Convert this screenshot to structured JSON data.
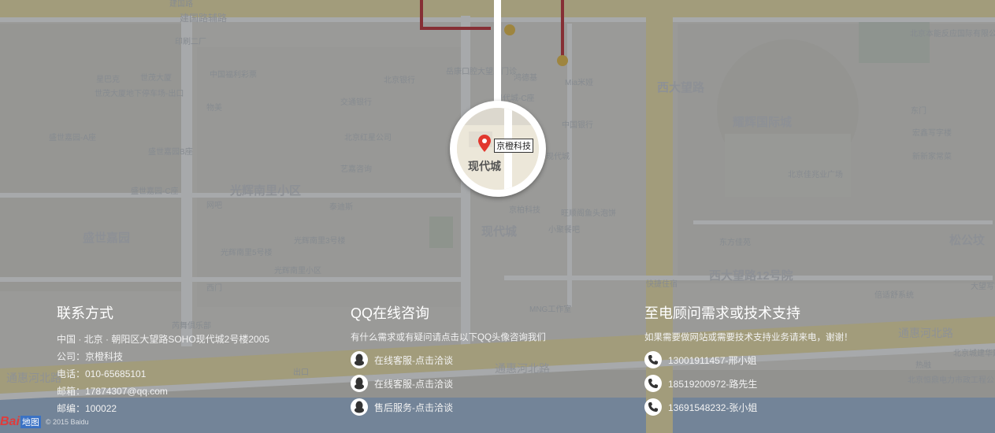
{
  "map": {
    "labels": [
      {
        "t": "建国路",
        "cls": ""
      },
      {
        "t": "建国路辅路",
        "cls": "mid"
      },
      {
        "t": "印刷二厂",
        "cls": ""
      },
      {
        "t": "中国福利彩票",
        "cls": ""
      },
      {
        "t": "北京银行",
        "cls": ""
      },
      {
        "t": "岳康口腔大望路门诊",
        "cls": ""
      },
      {
        "t": "鸿德基",
        "cls": ""
      },
      {
        "t": "Mia米娅",
        "cls": ""
      },
      {
        "t": "星巴克",
        "cls": ""
      },
      {
        "t": "世茂大厦",
        "cls": ""
      },
      {
        "t": "世茂大厦地下停车场-出口",
        "cls": ""
      },
      {
        "t": "物美",
        "cls": ""
      },
      {
        "t": "交通银行",
        "cls": ""
      },
      {
        "t": "现代城-C座",
        "cls": ""
      },
      {
        "t": "中国银行",
        "cls": ""
      },
      {
        "t": "盛世嘉园-A座",
        "cls": ""
      },
      {
        "t": "北京红星公司",
        "cls": ""
      },
      {
        "t": "现代城",
        "cls": ""
      },
      {
        "t": "盛世嘉园B座",
        "cls": ""
      },
      {
        "t": "艺嘉咨询",
        "cls": ""
      },
      {
        "t": "光辉南里小区",
        "cls": "big"
      },
      {
        "t": "盛世嘉园-C座",
        "cls": ""
      },
      {
        "t": "网吧",
        "cls": ""
      },
      {
        "t": "泰迪斯",
        "cls": ""
      },
      {
        "t": "旺顺阁鱼头泡饼",
        "cls": ""
      },
      {
        "t": "盛世嘉园",
        "cls": "big"
      },
      {
        "t": "现代城",
        "cls": "big"
      },
      {
        "t": "小聚餐吧",
        "cls": ""
      },
      {
        "t": "光辉南里3号楼",
        "cls": ""
      },
      {
        "t": "光辉南里5号楼",
        "cls": ""
      },
      {
        "t": "光辉南里小区",
        "cls": ""
      },
      {
        "t": "西门",
        "cls": ""
      },
      {
        "t": "MNG工作室",
        "cls": ""
      },
      {
        "t": "芮舞俱乐部",
        "cls": ""
      },
      {
        "t": "耀辉国际城",
        "cls": "big"
      },
      {
        "t": "西大望路",
        "cls": "big"
      },
      {
        "t": "东方佳苑",
        "cls": ""
      },
      {
        "t": "松公坟",
        "cls": "big"
      },
      {
        "t": "西大望路12号院",
        "cls": "big"
      },
      {
        "t": "快捷住宿",
        "cls": ""
      },
      {
        "t": "大望写字楼",
        "cls": ""
      },
      {
        "t": "倍适舒系统",
        "cls": ""
      },
      {
        "t": "北京本能反应国际有限公司",
        "cls": ""
      },
      {
        "t": "宏鑫写字楼",
        "cls": ""
      },
      {
        "t": "新新家常菜",
        "cls": ""
      },
      {
        "t": "北京佳兆业广场",
        "cls": ""
      },
      {
        "t": "东门",
        "cls": ""
      },
      {
        "t": "通惠河北路",
        "cls": "road"
      },
      {
        "t": "通惠河北路",
        "cls": "road"
      },
      {
        "t": "通惠河北路",
        "cls": "road"
      },
      {
        "t": "北京城建华建筑工程公司",
        "cls": ""
      },
      {
        "t": "北京恒鼎电力市政工程公司",
        "cls": ""
      },
      {
        "t": "热融",
        "cls": ""
      },
      {
        "t": "出口",
        "cls": ""
      },
      {
        "t": "京柏科技",
        "cls": ""
      }
    ],
    "magnifier_place": "现代城",
    "location_label": "京橙科技",
    "attribution": "© 2015 Baidu",
    "logo_text": "Bai",
    "logo_sub": "地图"
  },
  "contact": {
    "title": "联系方式",
    "address": "中国 · 北京 · 朝阳区大望路SOHO现代城2号楼2005",
    "company": "公司：京橙科技",
    "phone": "电话：010-65685101",
    "email": "邮箱：17874307@qq.com",
    "zip": "邮编：100022"
  },
  "qq": {
    "title": "QQ在线咨询",
    "subtitle": "有什么需求或有疑问请点击以下QQ头像咨询我们",
    "items": [
      {
        "label": "在线客服-点击洽谈"
      },
      {
        "label": "在线客服-点击洽谈"
      },
      {
        "label": "售后服务-点击洽谈"
      }
    ]
  },
  "support": {
    "title": "至电顾问需求或技术支持",
    "subtitle": "如果需要做网站或需要技术支持业务请来电，谢谢！",
    "phones": [
      {
        "label": "13001911457-邢小姐"
      },
      {
        "label": "18519200972-路先生"
      },
      {
        "label": "13691548232-张小姐"
      }
    ]
  }
}
